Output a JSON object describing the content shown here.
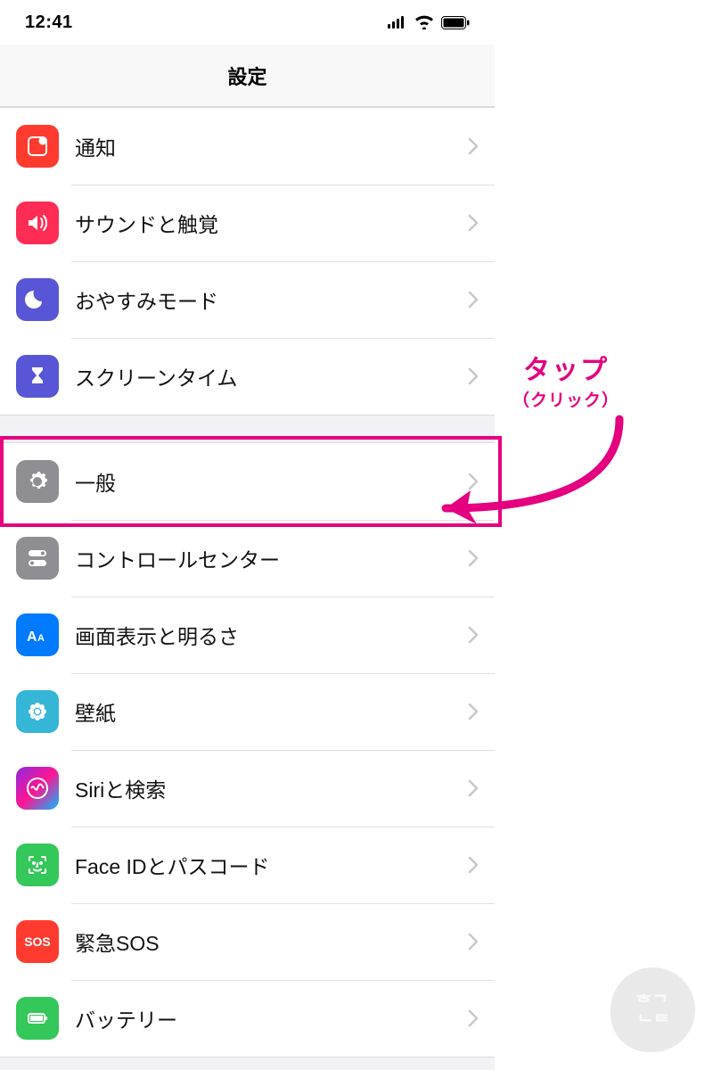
{
  "status": {
    "time": "12:41"
  },
  "header": {
    "title": "設定"
  },
  "annotation": {
    "line1": "タップ",
    "line2": "（クリック）"
  },
  "groups": [
    {
      "items": [
        {
          "key": "notifications",
          "label": "通知",
          "iconClass": "ic-notif",
          "iconName": "notification-icon"
        },
        {
          "key": "sound",
          "label": "サウンドと触覚",
          "iconClass": "ic-sound",
          "iconName": "sound-icon"
        },
        {
          "key": "dnd",
          "label": "おやすみモード",
          "iconClass": "ic-dnd",
          "iconName": "moon-icon"
        },
        {
          "key": "screentime",
          "label": "スクリーンタイム",
          "iconClass": "ic-screentime",
          "iconName": "hourglass-icon"
        }
      ]
    },
    {
      "items": [
        {
          "key": "general",
          "label": "一般",
          "iconClass": "ic-general",
          "iconName": "gear-icon",
          "highlight": true
        },
        {
          "key": "controlcenter",
          "label": "コントロールセンター",
          "iconClass": "ic-control",
          "iconName": "toggle-icon"
        },
        {
          "key": "display",
          "label": "画面表示と明るさ",
          "iconClass": "ic-display",
          "iconName": "text-size-icon"
        },
        {
          "key": "wallpaper",
          "label": "壁紙",
          "iconClass": "ic-wall",
          "iconName": "flower-icon"
        },
        {
          "key": "siri",
          "label": "Siriと検索",
          "iconClass": "ic-siri",
          "iconName": "siri-icon"
        },
        {
          "key": "faceid",
          "label": "Face IDとパスコード",
          "iconClass": "ic-faceid",
          "iconName": "face-id-icon"
        },
        {
          "key": "sos",
          "label": "緊急SOS",
          "iconClass": "ic-sos",
          "iconName": "sos-icon",
          "iconText": "SOS"
        },
        {
          "key": "battery",
          "label": "バッテリー",
          "iconClass": "ic-battery",
          "iconName": "battery-icon"
        }
      ]
    }
  ]
}
